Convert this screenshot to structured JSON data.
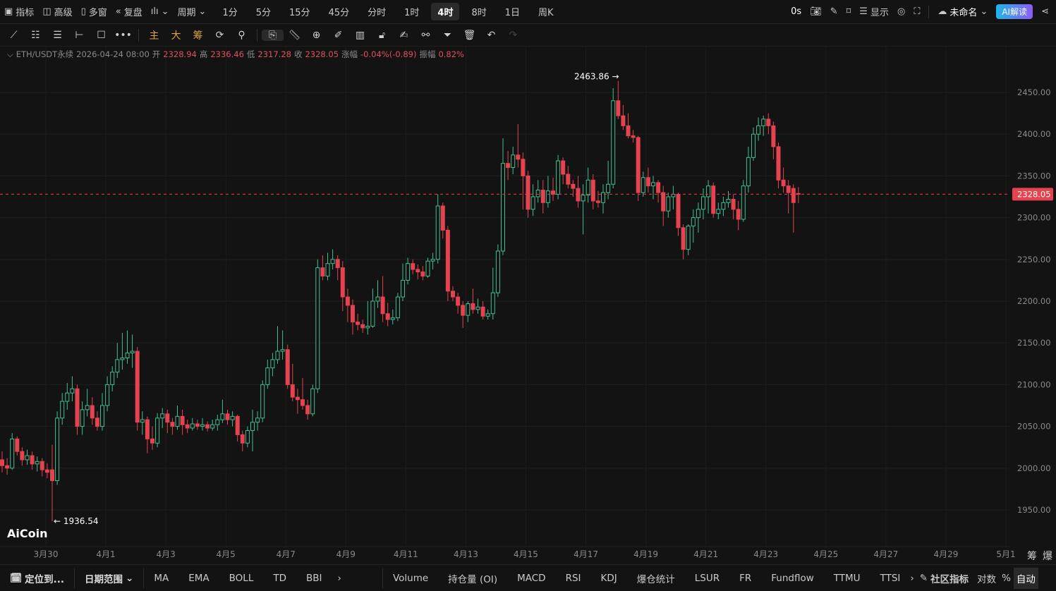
{
  "top": {
    "indicators": "指标",
    "advanced": "高级",
    "multi": "多窗",
    "replay": "复盘",
    "period": "周期",
    "periods": [
      "1分",
      "5分",
      "15分",
      "45分",
      "分时",
      "1时",
      "4时",
      "8时",
      "1日",
      "周K"
    ],
    "active_period": "4时",
    "countdown": "0s",
    "display": "显示",
    "layout_name": "未命名",
    "ai": "AI解读"
  },
  "toolbar": {
    "main": "主",
    "big": "大",
    "chips": "筹"
  },
  "info": {
    "symbol": "ETH/USDT永续",
    "time": "2026-04-24 08:00",
    "open_label": "开",
    "open": "2328.94",
    "high_label": "高",
    "high": "2336.46",
    "low_label": "低",
    "low": "2317.28",
    "close_label": "收",
    "close": "2328.05",
    "change_label": "涨幅",
    "change": "-0.04%(-0.89)",
    "amp_label": "振幅",
    "amp": "0.82%"
  },
  "chart_data": {
    "type": "candlestick",
    "symbol": "ETH/USDT永续",
    "interval": "4h",
    "ylim": [
      1925,
      2500
    ],
    "yticks": [
      2450,
      2400,
      2350,
      2300,
      2250,
      2200,
      2150,
      2100,
      2050,
      2000,
      1950
    ],
    "xticks": [
      "3月30",
      "4月1",
      "4月3",
      "4月5",
      "4月7",
      "4月9",
      "4月11",
      "4月13",
      "4月15",
      "4月17",
      "4月19",
      "4月21",
      "4月23",
      "4月25",
      "4月27",
      "4月29",
      "5月1"
    ],
    "current_price": "2328.05",
    "max_label": "2463.86",
    "min_label": "1936.54",
    "colors": {
      "up": "#3fbf91",
      "down": "#e4434f"
    },
    "ohlc": [
      [
        2010,
        2020,
        1995,
        2003
      ],
      [
        2003,
        2012,
        1992,
        2000
      ],
      [
        2000,
        2042,
        1998,
        2035
      ],
      [
        2035,
        2038,
        2015,
        2020
      ],
      [
        2020,
        2025,
        2003,
        2010
      ],
      [
        2010,
        2022,
        2004,
        2015
      ],
      [
        2015,
        2020,
        1998,
        2005
      ],
      [
        2005,
        2014,
        1996,
        2008
      ],
      [
        2008,
        2012,
        1990,
        1998
      ],
      [
        1998,
        2006,
        1988,
        1995
      ],
      [
        1998,
        2028,
        1936.54,
        1985
      ],
      [
        1985,
        2068,
        1980,
        2060
      ],
      [
        2060,
        2090,
        2052,
        2080
      ],
      [
        2080,
        2102,
        2070,
        2090
      ],
      [
        2090,
        2110,
        2080,
        2095
      ],
      [
        2095,
        2100,
        2040,
        2050
      ],
      [
        2050,
        2080,
        2040,
        2070
      ],
      [
        2070,
        2095,
        2062,
        2075
      ],
      [
        2075,
        2085,
        2052,
        2060
      ],
      [
        2060,
        2068,
        2045,
        2050
      ],
      [
        2050,
        2090,
        2045,
        2075
      ],
      [
        2075,
        2110,
        2068,
        2100
      ],
      [
        2100,
        2122,
        2092,
        2115
      ],
      [
        2115,
        2150,
        2108,
        2130
      ],
      [
        2130,
        2162,
        2118,
        2132
      ],
      [
        2132,
        2165,
        2125,
        2138
      ],
      [
        2138,
        2160,
        2120,
        2140
      ],
      [
        2140,
        2145,
        2045,
        2055
      ],
      [
        2055,
        2068,
        2040,
        2058
      ],
      [
        2058,
        2062,
        2018,
        2035
      ],
      [
        2035,
        2050,
        2022,
        2030
      ],
      [
        2030,
        2066,
        2025,
        2060
      ],
      [
        2060,
        2072,
        2048,
        2065
      ],
      [
        2065,
        2070,
        2042,
        2055
      ],
      [
        2055,
        2060,
        2040,
        2050
      ],
      [
        2050,
        2075,
        2046,
        2062
      ],
      [
        2062,
        2070,
        2040,
        2052
      ],
      [
        2052,
        2058,
        2042,
        2048
      ],
      [
        2048,
        2060,
        2045,
        2053
      ],
      [
        2053,
        2058,
        2046,
        2050
      ],
      [
        2050,
        2060,
        2045,
        2052
      ],
      [
        2052,
        2056,
        2044,
        2048
      ],
      [
        2048,
        2058,
        2045,
        2052
      ],
      [
        2052,
        2064,
        2045,
        2058
      ],
      [
        2058,
        2082,
        2054,
        2065
      ],
      [
        2065,
        2070,
        2052,
        2058
      ],
      [
        2058,
        2068,
        2050,
        2062
      ],
      [
        2062,
        2064,
        2032,
        2040
      ],
      [
        2040,
        2045,
        2020,
        2030
      ],
      [
        2030,
        2050,
        2025,
        2045
      ],
      [
        2045,
        2070,
        2020,
        2055
      ],
      [
        2055,
        2068,
        2045,
        2060
      ],
      [
        2060,
        2105,
        2055,
        2100
      ],
      [
        2100,
        2130,
        2095,
        2120
      ],
      [
        2120,
        2138,
        2110,
        2130
      ],
      [
        2130,
        2170,
        2125,
        2140
      ],
      [
        2140,
        2165,
        2130,
        2142
      ],
      [
        2142,
        2148,
        2095,
        2100
      ],
      [
        2100,
        2125,
        2080,
        2085
      ],
      [
        2085,
        2095,
        2065,
        2082
      ],
      [
        2082,
        2108,
        2070,
        2075
      ],
      [
        2075,
        2082,
        2058,
        2065
      ],
      [
        2065,
        2100,
        2062,
        2095
      ],
      [
        2095,
        2250,
        2090,
        2240
      ],
      [
        2240,
        2255,
        2225,
        2230
      ],
      [
        2230,
        2258,
        2225,
        2245
      ],
      [
        2245,
        2262,
        2238,
        2250
      ],
      [
        2250,
        2255,
        2225,
        2240
      ],
      [
        2240,
        2248,
        2188,
        2205
      ],
      [
        2205,
        2215,
        2175,
        2195
      ],
      [
        2195,
        2202,
        2160,
        2175
      ],
      [
        2175,
        2185,
        2165,
        2172
      ],
      [
        2172,
        2178,
        2162,
        2168
      ],
      [
        2168,
        2200,
        2160,
        2170
      ],
      [
        2170,
        2215,
        2168,
        2200
      ],
      [
        2200,
        2225,
        2192,
        2205
      ],
      [
        2205,
        2230,
        2175,
        2185
      ],
      [
        2185,
        2198,
        2170,
        2178
      ],
      [
        2178,
        2190,
        2172,
        2180
      ],
      [
        2180,
        2210,
        2176,
        2205
      ],
      [
        2205,
        2245,
        2200,
        2225
      ],
      [
        2225,
        2252,
        2220,
        2245
      ],
      [
        2245,
        2250,
        2232,
        2238
      ],
      [
        2238,
        2244,
        2226,
        2235
      ],
      [
        2235,
        2242,
        2225,
        2230
      ],
      [
        2230,
        2252,
        2228,
        2248
      ],
      [
        2248,
        2258,
        2238,
        2250
      ],
      [
        2250,
        2328,
        2245,
        2314
      ],
      [
        2314,
        2318,
        2275,
        2285
      ],
      [
        2285,
        2290,
        2200,
        2212
      ],
      [
        2212,
        2218,
        2200,
        2205
      ],
      [
        2205,
        2210,
        2185,
        2195
      ],
      [
        2195,
        2200,
        2168,
        2183
      ],
      [
        2183,
        2200,
        2175,
        2197
      ],
      [
        2197,
        2215,
        2185,
        2190
      ],
      [
        2190,
        2203,
        2185,
        2193
      ],
      [
        2193,
        2200,
        2178,
        2182
      ],
      [
        2182,
        2190,
        2178,
        2185
      ],
      [
        2185,
        2240,
        2178,
        2210
      ],
      [
        2210,
        2268,
        2205,
        2260
      ],
      [
        2260,
        2395,
        2255,
        2365
      ],
      [
        2365,
        2380,
        2345,
        2360
      ],
      [
        2360,
        2385,
        2352,
        2375
      ],
      [
        2375,
        2412,
        2360,
        2370
      ],
      [
        2370,
        2378,
        2310,
        2350
      ],
      [
        2350,
        2356,
        2300,
        2310
      ],
      [
        2310,
        2340,
        2302,
        2325
      ],
      [
        2325,
        2345,
        2318,
        2333
      ],
      [
        2333,
        2345,
        2305,
        2318
      ],
      [
        2318,
        2350,
        2312,
        2332
      ],
      [
        2332,
        2348,
        2320,
        2328
      ],
      [
        2328,
        2375,
        2322,
        2368
      ],
      [
        2368,
        2372,
        2340,
        2352
      ],
      [
        2352,
        2362,
        2335,
        2340
      ],
      [
        2340,
        2345,
        2325,
        2335
      ],
      [
        2335,
        2350,
        2312,
        2320
      ],
      [
        2320,
        2340,
        2280,
        2327
      ],
      [
        2327,
        2360,
        2318,
        2345
      ],
      [
        2345,
        2352,
        2310,
        2320
      ],
      [
        2320,
        2332,
        2312,
        2318
      ],
      [
        2318,
        2340,
        2305,
        2330
      ],
      [
        2330,
        2368,
        2322,
        2340
      ],
      [
        2340,
        2455,
        2335,
        2440
      ],
      [
        2440,
        2463.86,
        2418,
        2422
      ],
      [
        2422,
        2435,
        2405,
        2410
      ],
      [
        2410,
        2425,
        2395,
        2398
      ],
      [
        2398,
        2405,
        2390,
        2396
      ],
      [
        2396,
        2398,
        2320,
        2330
      ],
      [
        2330,
        2355,
        2325,
        2348
      ],
      [
        2348,
        2360,
        2330,
        2338
      ],
      [
        2338,
        2350,
        2322,
        2342
      ],
      [
        2342,
        2345,
        2318,
        2330
      ],
      [
        2330,
        2338,
        2290,
        2308
      ],
      [
        2308,
        2330,
        2300,
        2325
      ],
      [
        2325,
        2338,
        2310,
        2328
      ],
      [
        2328,
        2330,
        2278,
        2288
      ],
      [
        2288,
        2292,
        2250,
        2262
      ],
      [
        2262,
        2292,
        2255,
        2290
      ],
      [
        2290,
        2310,
        2270,
        2300
      ],
      [
        2300,
        2318,
        2282,
        2310
      ],
      [
        2310,
        2335,
        2298,
        2325
      ],
      [
        2325,
        2345,
        2305,
        2338
      ],
      [
        2338,
        2342,
        2300,
        2305
      ],
      [
        2305,
        2318,
        2298,
        2310
      ],
      [
        2310,
        2325,
        2302,
        2318
      ],
      [
        2318,
        2332,
        2312,
        2322
      ],
      [
        2322,
        2328,
        2298,
        2310
      ],
      [
        2310,
        2320,
        2285,
        2298
      ],
      [
        2298,
        2345,
        2295,
        2338
      ],
      [
        2338,
        2385,
        2330,
        2372
      ],
      [
        2372,
        2408,
        2368,
        2400
      ],
      [
        2400,
        2420,
        2392,
        2410
      ],
      [
        2410,
        2422,
        2398,
        2418
      ],
      [
        2418,
        2425,
        2400,
        2410
      ],
      [
        2410,
        2415,
        2370,
        2385
      ],
      [
        2385,
        2390,
        2335,
        2345
      ],
      [
        2345,
        2360,
        2330,
        2338
      ],
      [
        2338,
        2345,
        2305,
        2330
      ],
      [
        2335,
        2340,
        2282,
        2318
      ],
      [
        2328.94,
        2336.46,
        2317.28,
        2328.05
      ]
    ]
  },
  "axis_side": {
    "chips": "筹",
    "liq": "爆"
  },
  "logo": "AiCoin",
  "bottom": {
    "locate": "定位到...",
    "range": "日期范围",
    "main_ind": [
      "MA",
      "EMA",
      "BOLL",
      "TD",
      "BBI"
    ],
    "sub_ind": [
      "Volume",
      "持仓量 (OI)",
      "MACD",
      "RSI",
      "KDJ",
      "爆仓统计",
      "LSUR",
      "FR",
      "Fundflow",
      "TTMU",
      "TTSI"
    ],
    "community": "社区指标",
    "log": "对数",
    "pct": "%",
    "auto": "自动"
  }
}
